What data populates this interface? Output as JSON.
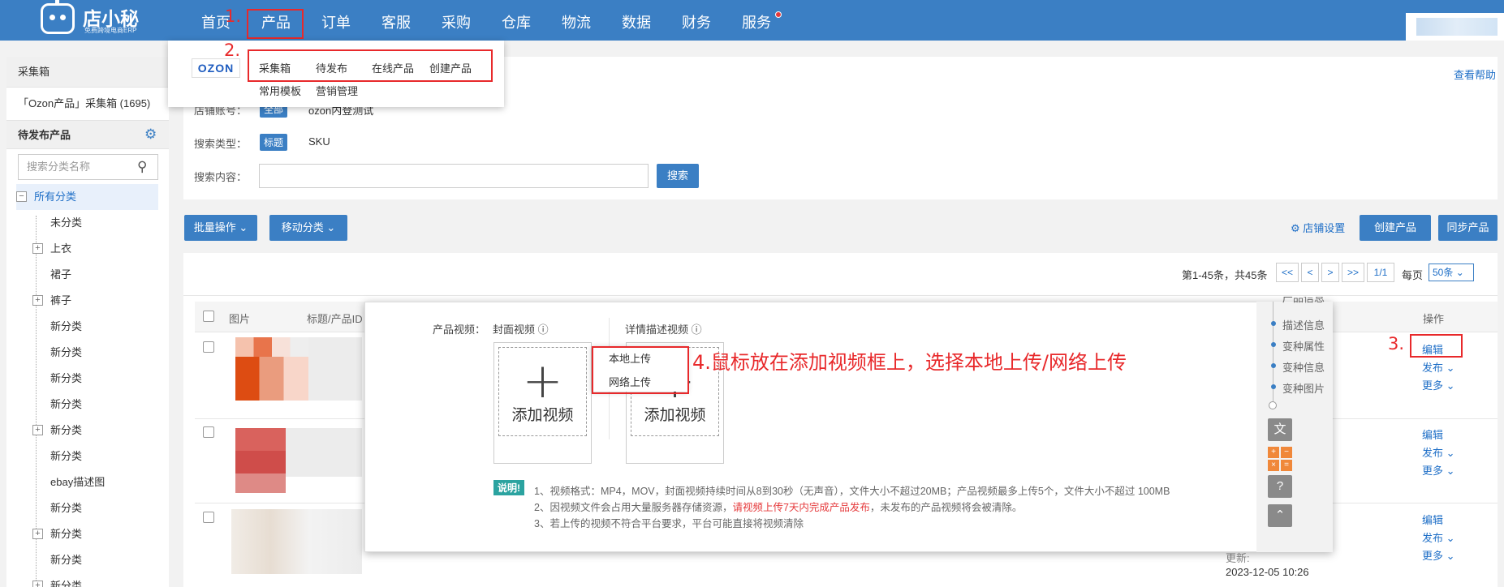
{
  "header": {
    "logo_name": "店小秘",
    "logo_sub": "免费跨境电商ERP",
    "nav": [
      "首页",
      "产品",
      "订单",
      "客服",
      "采购",
      "仓库",
      "物流",
      "数据",
      "财务",
      "服务"
    ]
  },
  "menu_popup": {
    "platform_logo": "OZON",
    "items_row1": [
      "采集箱",
      "待发布",
      "在线产品",
      "创建产品"
    ],
    "items_row2": [
      "常用模板",
      "营销管理"
    ]
  },
  "annotations": {
    "step1": "1.",
    "step2": "2.",
    "step3": "3.",
    "step4": "4.鼠标放在添加视频框上，选择本地上传/网络上传"
  },
  "sidebar": {
    "collect_title": "采集箱",
    "collect_item": "「Ozon产品」采集箱 (1695)",
    "pending_title": "待发布产品",
    "search_placeholder": "搜索分类名称",
    "root": "所有分类",
    "categories": [
      "未分类",
      "上衣",
      "裙子",
      "裤子",
      "新分类",
      "新分类",
      "新分类",
      "新分类",
      "新分类",
      "新分类",
      "ebay描述图",
      "新分类",
      "新分类",
      "新分类",
      "新分类"
    ]
  },
  "filters": {
    "help": "查看帮助",
    "shop_label": "店铺账号：",
    "shop_tag": "全部",
    "shop_value": "ozon内登测试",
    "search_type_label": "搜索类型：",
    "type_tag": "标题",
    "type_sku": "SKU",
    "content_label": "搜索内容：",
    "search_btn": "搜索"
  },
  "toolbar": {
    "batch": "批量操作",
    "move": "移动分类",
    "shop_settings": "店铺设置",
    "create": "创建产品",
    "sync": "同步产品"
  },
  "pagination": {
    "summary": "第1-45条，共45条",
    "first": "<<",
    "prev": "<",
    "next": ">",
    "last": ">>",
    "page": "1/1",
    "per_page_label": "每页",
    "per_page": "50条"
  },
  "table": {
    "col_image": "图片",
    "col_title": "标题/产品ID",
    "col_ops": "操作",
    "rows": [
      {
        "edit": "编辑",
        "publish": "发布",
        "more": "更多"
      },
      {
        "edit": "编辑",
        "publish": "发布",
        "more": "更多"
      },
      {
        "edit": "编辑",
        "publish": "发布",
        "more": "更多"
      }
    ],
    "update_label": "更新:",
    "update_time": "2023-12-05 10:26"
  },
  "video_modal": {
    "label": "产品视频：",
    "cover_title": "封面视频",
    "detail_title": "详情描述视频",
    "add_video": "添加视频",
    "dropdown": [
      "本地上传",
      "网络上传"
    ],
    "note_tag": "说明!",
    "note1": "1、视频格式：MP4，MOV，封面视频持续时间从8到30秒（无声音），文件大小不超过20MB；产品视频最多上传5个，文件大小不超过 100MB",
    "note2_pre": "2、因视频文件会占用大量服务器存储资源，",
    "note2_red": "请视频上传7天内完成产品发布",
    "note2_post": "，未发布的产品视频将会被清除。",
    "note3": "3、若上传的视频不符合平台要求，平台可能直接将视频清除",
    "side_nav": [
      "产品信息",
      "描述信息",
      "变种属性",
      "变种信息",
      "变种图片"
    ]
  },
  "colors": {
    "topbar": "#3b7fc4",
    "annotation_red": "#e8292b",
    "note_teal": "#2ba3a0"
  }
}
